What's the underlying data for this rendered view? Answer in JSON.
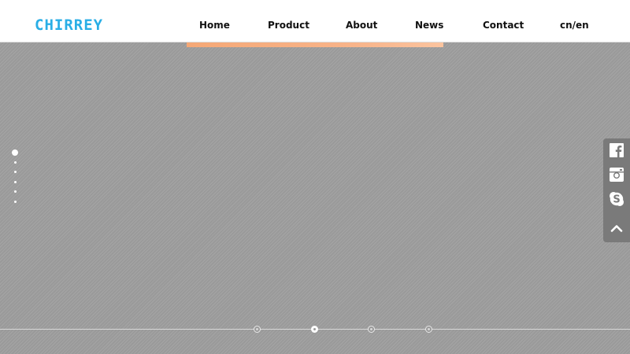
{
  "brand": {
    "logo_text": "CHIRREY",
    "logo_color": "#29aee6"
  },
  "nav": {
    "items": [
      {
        "label": "Home"
      },
      {
        "label": "Product"
      },
      {
        "label": "About"
      },
      {
        "label": "News"
      },
      {
        "label": "Contact"
      },
      {
        "label": "cn/en"
      }
    ]
  },
  "hero": {
    "background_color": "#9a9a9a",
    "active_slide": 1,
    "slide_count": 6
  },
  "social": {
    "items": [
      {
        "icon": "facebook-icon"
      },
      {
        "icon": "instagram-icon"
      },
      {
        "icon": "skype-icon"
      },
      {
        "icon": "chevron-up-icon"
      }
    ]
  },
  "timeline": {
    "dot_count": 4,
    "active_dot": 2
  },
  "colors": {
    "accent_orange": "#f5a876",
    "panel_gray": "#7a7a7a"
  }
}
